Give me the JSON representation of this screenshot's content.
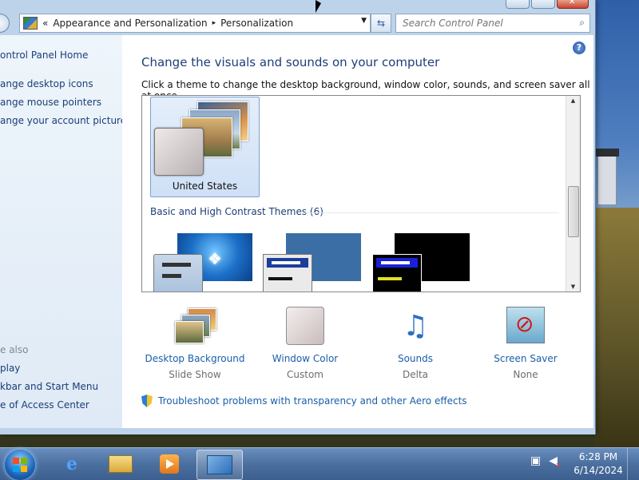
{
  "address": {
    "overflow": "«",
    "crumbs": [
      "Appearance and Personalization",
      "Personalization"
    ],
    "separator": "▸"
  },
  "search": {
    "placeholder": "Search Control Panel"
  },
  "left_pane": {
    "home": "ontrol Panel Home",
    "links": [
      "ange desktop icons",
      "ange mouse pointers",
      "ange your account picture"
    ],
    "see_also_heading": "e also",
    "see_also": [
      "play",
      "kbar and Start Menu",
      "e of Access Center"
    ]
  },
  "main": {
    "title": "Change the visuals and sounds on your computer",
    "subtitle": "Click a theme to change the desktop background, window color, sounds, and screen saver all at once.",
    "selected_theme": "United States",
    "group_title": "Basic and High Contrast Themes (6)",
    "options": [
      {
        "name": "Desktop Background",
        "value": "Slide Show"
      },
      {
        "name": "Window Color",
        "value": "Custom"
      },
      {
        "name": "Sounds",
        "value": "Delta"
      },
      {
        "name": "Screen Saver",
        "value": "None"
      }
    ],
    "troubleshoot": "Troubleshoot problems with transparency and other Aero effects"
  },
  "taskbar": {
    "time": "6:28 PM",
    "date": "6/14/2024"
  },
  "icons": {
    "help": "help-icon",
    "search": "magnifier-icon",
    "refresh": "refresh-icon"
  }
}
